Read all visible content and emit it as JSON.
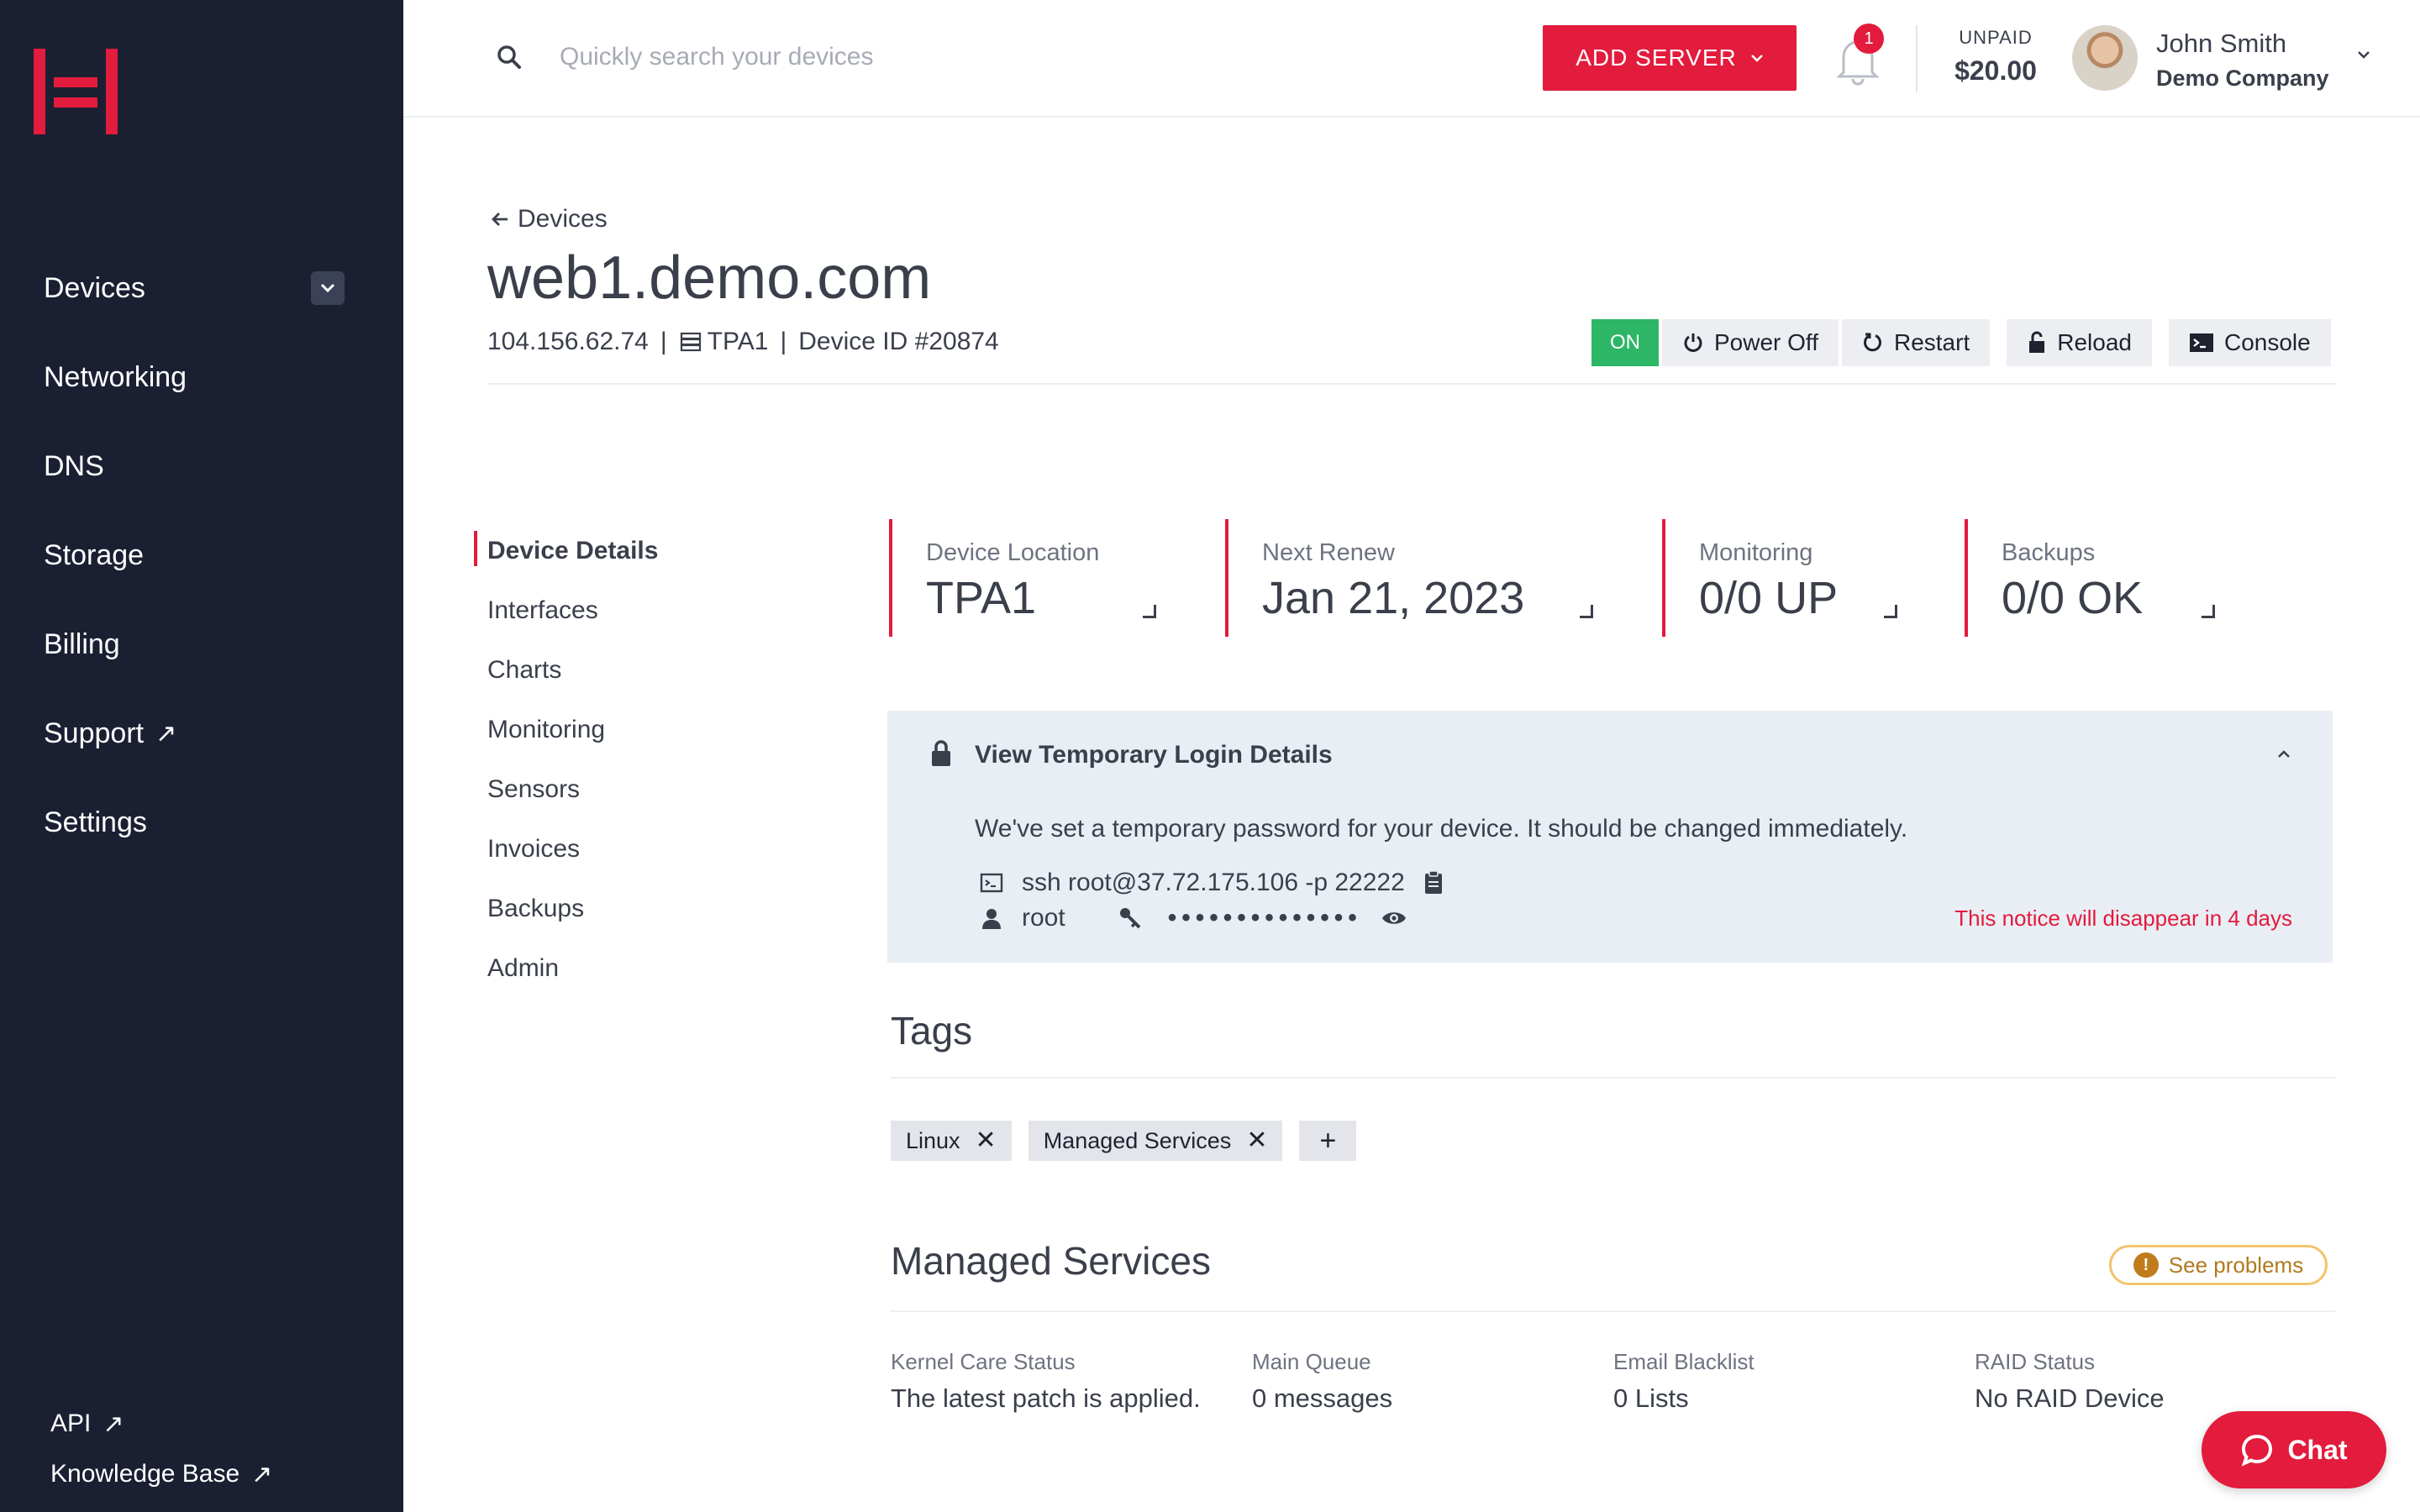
{
  "brand": {
    "accent": "#e31b3c",
    "sidebar_bg": "#1b1f32",
    "on_green": "#2cb665"
  },
  "sidebar": {
    "items": [
      {
        "label": "Devices",
        "has_caret": true
      },
      {
        "label": "Networking"
      },
      {
        "label": "DNS"
      },
      {
        "label": "Storage"
      },
      {
        "label": "Billing"
      },
      {
        "label": "Support",
        "external": true
      },
      {
        "label": "Settings"
      }
    ],
    "bottom": [
      {
        "label": "API",
        "external": true
      },
      {
        "label": "Knowledge Base",
        "external": true
      }
    ]
  },
  "topbar": {
    "search_placeholder": "Quickly search your devices",
    "add_server_label": "ADD SERVER",
    "notification_count": "1",
    "unpaid_label": "UNPAID",
    "unpaid_amount": "$20.00",
    "user_name": "John Smith",
    "user_company": "Demo Company"
  },
  "header": {
    "back_label": "Devices",
    "title": "web1.demo.com",
    "ip": "104.156.62.74",
    "location": "TPA1",
    "device_id": "Device ID #20874",
    "power_state": "ON",
    "actions": {
      "power_off": "Power Off",
      "restart": "Restart",
      "reload": "Reload",
      "console": "Console"
    }
  },
  "subnav": {
    "items": [
      {
        "label": "Device Details",
        "active": true
      },
      {
        "label": "Interfaces"
      },
      {
        "label": "Charts"
      },
      {
        "label": "Monitoring"
      },
      {
        "label": "Sensors"
      },
      {
        "label": "Invoices"
      },
      {
        "label": "Backups"
      },
      {
        "label": "Admin"
      }
    ]
  },
  "stats": [
    {
      "label": "Device Location",
      "value": "TPA1"
    },
    {
      "label": "Next Renew",
      "value": "Jan 21, 2023"
    },
    {
      "label": "Monitoring",
      "value": "0/0 UP"
    },
    {
      "label": "Backups",
      "value": "0/0 OK"
    }
  ],
  "login_panel": {
    "title": "View Temporary Login Details",
    "message": "We've set a temporary password for your device. It should be changed immediately.",
    "ssh_command": "ssh root@37.72.175.106 -p 22222",
    "username": "root",
    "password_mask": "••••••••••••••",
    "notice": "This notice will disappear in 4 days"
  },
  "tags": {
    "heading": "Tags",
    "items": [
      "Linux",
      "Managed Services"
    ],
    "add_label": "+"
  },
  "managed_services": {
    "heading": "Managed Services",
    "problems_label": "See problems",
    "columns": [
      {
        "label": "Kernel Care Status",
        "value": "The latest patch is applied."
      },
      {
        "label": "Main Queue",
        "value": "0 messages"
      },
      {
        "label": "Email Blacklist",
        "value": "0 Lists"
      },
      {
        "label": "RAID Status",
        "value": "No RAID Device"
      }
    ]
  },
  "chat_label": "Chat"
}
